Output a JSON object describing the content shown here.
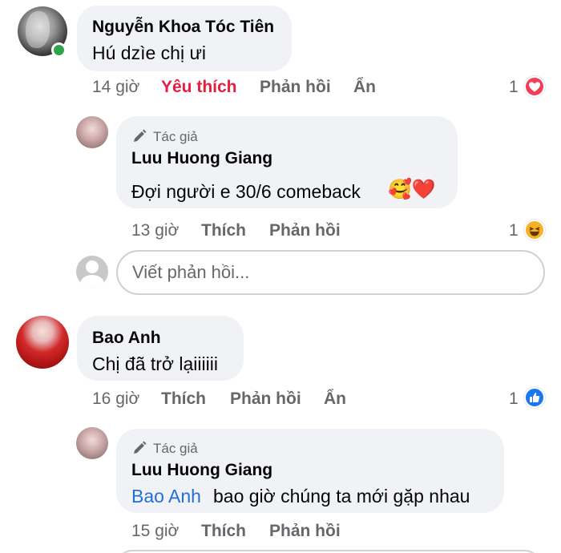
{
  "comments": [
    {
      "author": "Nguyễn Khoa Tóc Tiên",
      "text": "Hú dzìe chị ưi",
      "time": "14 giờ",
      "like_label": "Yêu thích",
      "reply_label": "Phản hồi",
      "hide_label": "Ẩn",
      "reaction_count": "1",
      "reaction_icon": "heart-icon",
      "online": true
    },
    {
      "author_tag": "Tác giả",
      "author": "Luu Huong Giang",
      "text": "Đợi người e 30/6 comeback",
      "emoji": "🥰❤️",
      "time": "13 giờ",
      "like_label": "Thích",
      "reply_label": "Phản hồi",
      "reaction_count": "1",
      "reaction_icon": "haha-icon"
    },
    {
      "author": "Bao Anh",
      "text": "Chị đã trở lạiiiiii",
      "time": "16 giờ",
      "like_label": "Thích",
      "reply_label": "Phản hồi",
      "hide_label": "Ẩn",
      "reaction_count": "1",
      "reaction_icon": "like-icon"
    },
    {
      "author_tag": "Tác giả",
      "author": "Luu Huong Giang",
      "mention": "Bao Anh",
      "text": "bao giờ chúng ta mới gặp nhau",
      "time": "15 giờ",
      "like_label": "Thích",
      "reply_label": "Phản hồi"
    }
  ],
  "reply_input": {
    "placeholder": "Viết phản hồi..."
  },
  "colors": {
    "bubble": "#f0f2f5",
    "meta_text": "#65676b",
    "liked": "#e41e3f",
    "mention": "#216fdb",
    "online": "#31a24c"
  }
}
